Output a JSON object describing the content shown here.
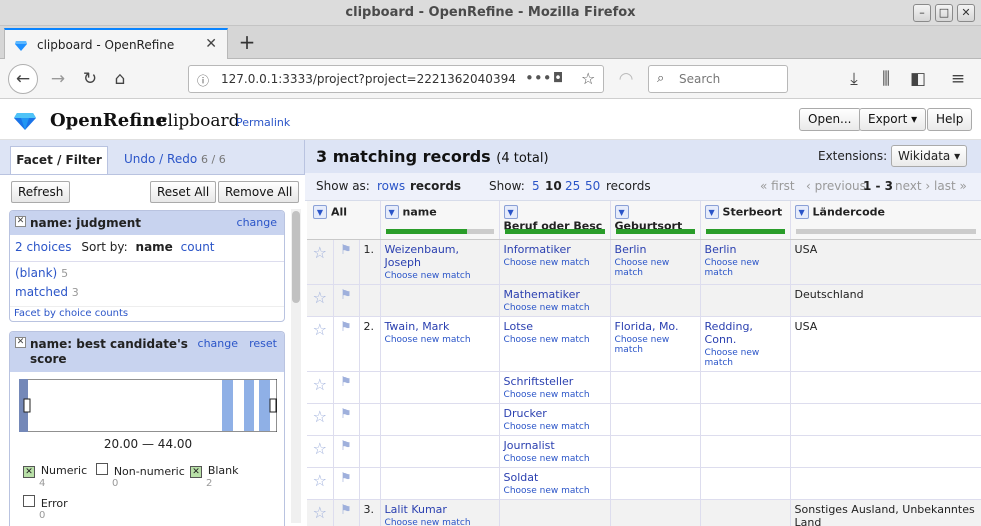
{
  "window": {
    "title": "clipboard - OpenRefine - Mozilla Firefox"
  },
  "browser": {
    "tab_title": "clipboard - OpenRefine",
    "url": "127.0.0.1:3333/project?project=2221362040394",
    "search_placeholder": "Search"
  },
  "header": {
    "logo": "OpenRefine",
    "project": "clipboard",
    "permalink": "Permalink",
    "buttons": {
      "open": "Open...",
      "export": "Export ▾",
      "help": "Help"
    }
  },
  "left": {
    "tab_facet": "Facet / Filter",
    "tab_undo": "Undo / Redo",
    "undo_count": "6 / 6",
    "refresh": "Refresh",
    "reset_all": "Reset All",
    "remove_all": "Remove All",
    "facet1": {
      "name": "name: judgment",
      "change": "change",
      "choices": "2 choices",
      "sort_by": "Sort by:",
      "sort_name": "name",
      "sort_count": "count",
      "items": [
        {
          "label": "(blank)",
          "count": "5"
        },
        {
          "label": "matched",
          "count": "3"
        }
      ],
      "footer": "Facet by choice counts"
    },
    "facet2": {
      "name_line1": "name: best candidate's",
      "name_line2": "score",
      "change": "change",
      "reset": "reset",
      "range": "20.00 — 44.00",
      "checks": [
        {
          "label": "Numeric",
          "count": "4",
          "checked": true
        },
        {
          "label": "Non-numeric",
          "count": "0",
          "checked": false
        },
        {
          "label": "Blank",
          "count": "2",
          "checked": true
        },
        {
          "label": "Error",
          "count": "0",
          "checked": false
        }
      ]
    }
  },
  "right": {
    "title": "3 matching records",
    "total": "(4 total)",
    "extensions_label": "Extensions:",
    "extensions_btn": "Wikidata ▾",
    "show_as": "Show as:",
    "rows": "rows",
    "records": "records",
    "show": "Show:",
    "page_sizes": [
      "5",
      "10",
      "25",
      "50"
    ],
    "page_unit": "records",
    "pager": {
      "first": "« first",
      "prev": "‹ previous",
      "range": "1 - 3",
      "next": "next ›",
      "last": "last »"
    },
    "columns": {
      "all": "All",
      "name": "name",
      "beruf": "Beruf oder Besc",
      "geburtsort": "Geburtsort",
      "sterbeort": "Sterbeort",
      "laendercode": "Ländercode"
    },
    "choose": "Choose new match",
    "rows_data": [
      {
        "num": "1.",
        "name": "Weizenbaum, Joseph",
        "beruf": "Informatiker",
        "geburtsort": "Berlin",
        "sterbeort": "Berlin",
        "land": "USA"
      },
      {
        "num": "",
        "name": "",
        "beruf": "Mathematiker",
        "geburtsort": "",
        "sterbeort": "",
        "land": "Deutschland"
      },
      {
        "num": "2.",
        "name": "Twain, Mark",
        "beruf": "Lotse",
        "geburtsort": "Florida, Mo.",
        "sterbeort": "Redding, Conn.",
        "land": "USA"
      },
      {
        "num": "",
        "name": "",
        "beruf": "Schriftsteller",
        "geburtsort": "",
        "sterbeort": "",
        "land": ""
      },
      {
        "num": "",
        "name": "",
        "beruf": "Drucker",
        "geburtsort": "",
        "sterbeort": "",
        "land": ""
      },
      {
        "num": "",
        "name": "",
        "beruf": "Journalist",
        "geburtsort": "",
        "sterbeort": "",
        "land": ""
      },
      {
        "num": "",
        "name": "",
        "beruf": "Soldat",
        "geburtsort": "",
        "sterbeort": "",
        "land": ""
      },
      {
        "num": "3.",
        "name": "Lalit Kumar",
        "beruf": "",
        "geburtsort": "",
        "sterbeort": "",
        "land": "Sonstiges Ausland, Unbekanntes Land"
      }
    ]
  }
}
